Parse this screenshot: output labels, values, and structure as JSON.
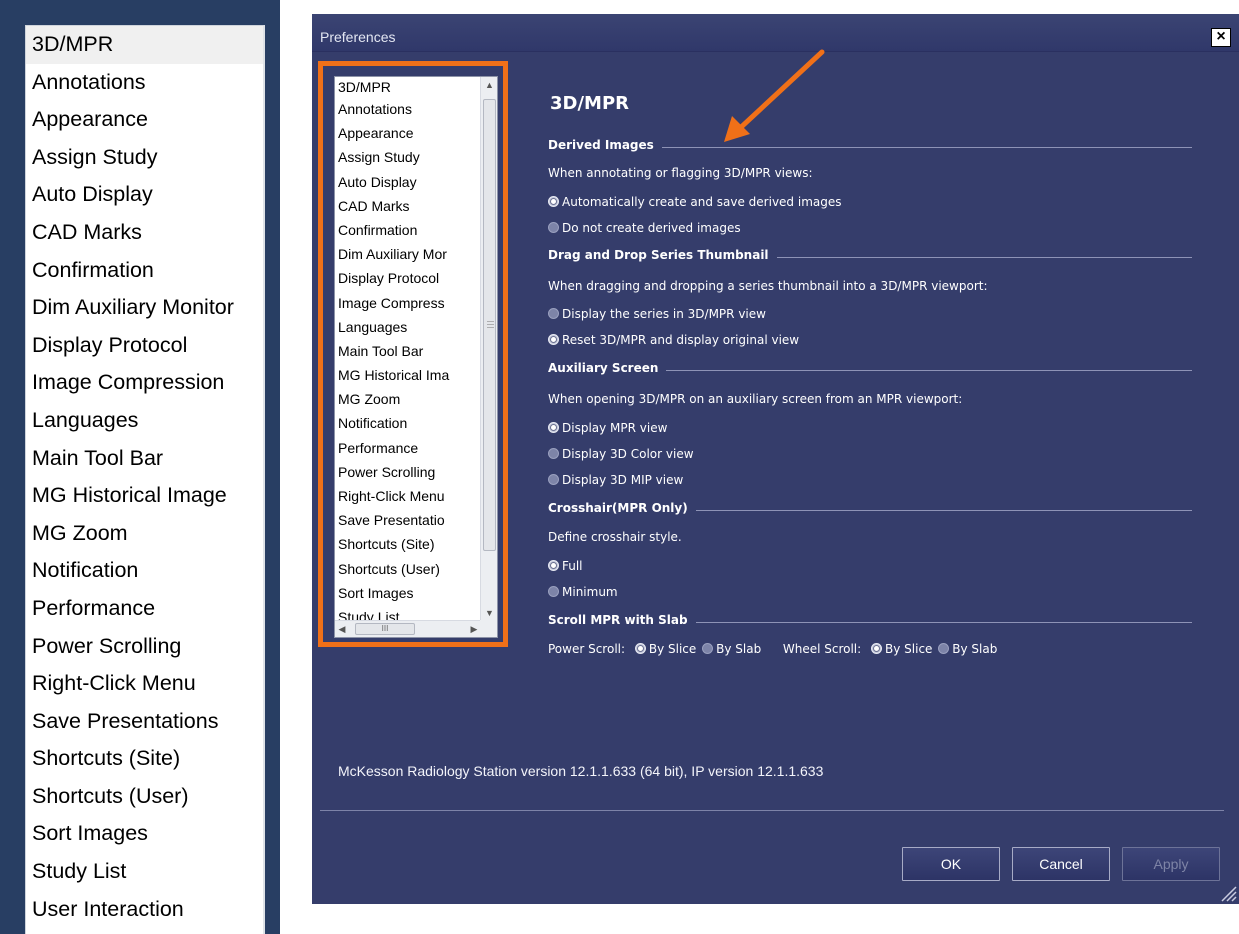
{
  "zoom_list": {
    "items": [
      "3D/MPR",
      "Annotations",
      "Appearance",
      "Assign Study",
      "Auto Display",
      "CAD Marks",
      "Confirmation",
      "Dim Auxiliary Monitor",
      "Display Protocol",
      "Image Compression",
      "Languages",
      "Main Tool Bar",
      "MG Historical Image",
      "MG Zoom",
      "Notification",
      "Performance",
      "Power Scrolling",
      "Right-Click Menu",
      "Save Presentations",
      "Shortcuts (Site)",
      "Shortcuts (User)",
      "Sort Images",
      "Study List",
      "User Interaction"
    ],
    "selected": "3D/MPR"
  },
  "dialog": {
    "title": "Preferences",
    "close_label": "×",
    "list": {
      "items": [
        "3D/MPR",
        "Annotations",
        "Appearance",
        "Assign Study",
        "Auto Display",
        "CAD Marks",
        "Confirmation",
        "Dim Auxiliary Mor",
        "Display Protocol",
        "Image Compress",
        "Languages",
        "Main Tool Bar",
        "MG Historical Ima",
        "MG Zoom",
        "Notification",
        "Performance",
        "Power Scrolling",
        "Right-Click Menu",
        "Save Presentatio",
        "Shortcuts (Site)",
        "Shortcuts (User)",
        "Sort Images",
        "Study List"
      ],
      "hscroll_grip": "III"
    },
    "section_title": "3D/MPR",
    "groups": {
      "derived": {
        "heading": "Derived Images",
        "prompt": "When annotating or flagging 3D/MPR views:",
        "options": [
          "Automatically create and save derived images",
          "Do not create derived images"
        ],
        "selected_index": 0
      },
      "dragdrop": {
        "heading": "Drag and Drop Series Thumbnail",
        "prompt": "When dragging and dropping a series thumbnail into a 3D/MPR viewport:",
        "options": [
          "Display the series in 3D/MPR view",
          "Reset 3D/MPR and display original view"
        ],
        "selected_index": 1
      },
      "aux": {
        "heading": "Auxiliary Screen",
        "prompt": "When opening 3D/MPR on an auxiliary screen from an MPR viewport:",
        "options": [
          "Display MPR view",
          "Display 3D Color view",
          "Display 3D MIP view"
        ],
        "selected_index": 0
      },
      "crosshair": {
        "heading": "Crosshair(MPR Only)",
        "prompt": "Define crosshair style.",
        "options": [
          "Full",
          "Minimum"
        ],
        "selected_index": 0
      },
      "scroll": {
        "heading": "Scroll MPR with Slab",
        "power_label": "Power Scroll:",
        "wheel_label": "Wheel Scroll:",
        "options": [
          "By Slice",
          "By Slab"
        ],
        "power_selected_index": 0,
        "wheel_selected_index": 0
      }
    },
    "version": "McKesson Radiology Station version 12.1.1.633 (64 bit),  IP version 12.1.1.633",
    "buttons": {
      "ok": "OK",
      "cancel": "Cancel",
      "apply": "Apply",
      "apply_enabled": false
    }
  },
  "colors": {
    "dialog_bg": "#353d6b",
    "highlight": "#f07018",
    "left_panel_bg": "#283e63"
  }
}
